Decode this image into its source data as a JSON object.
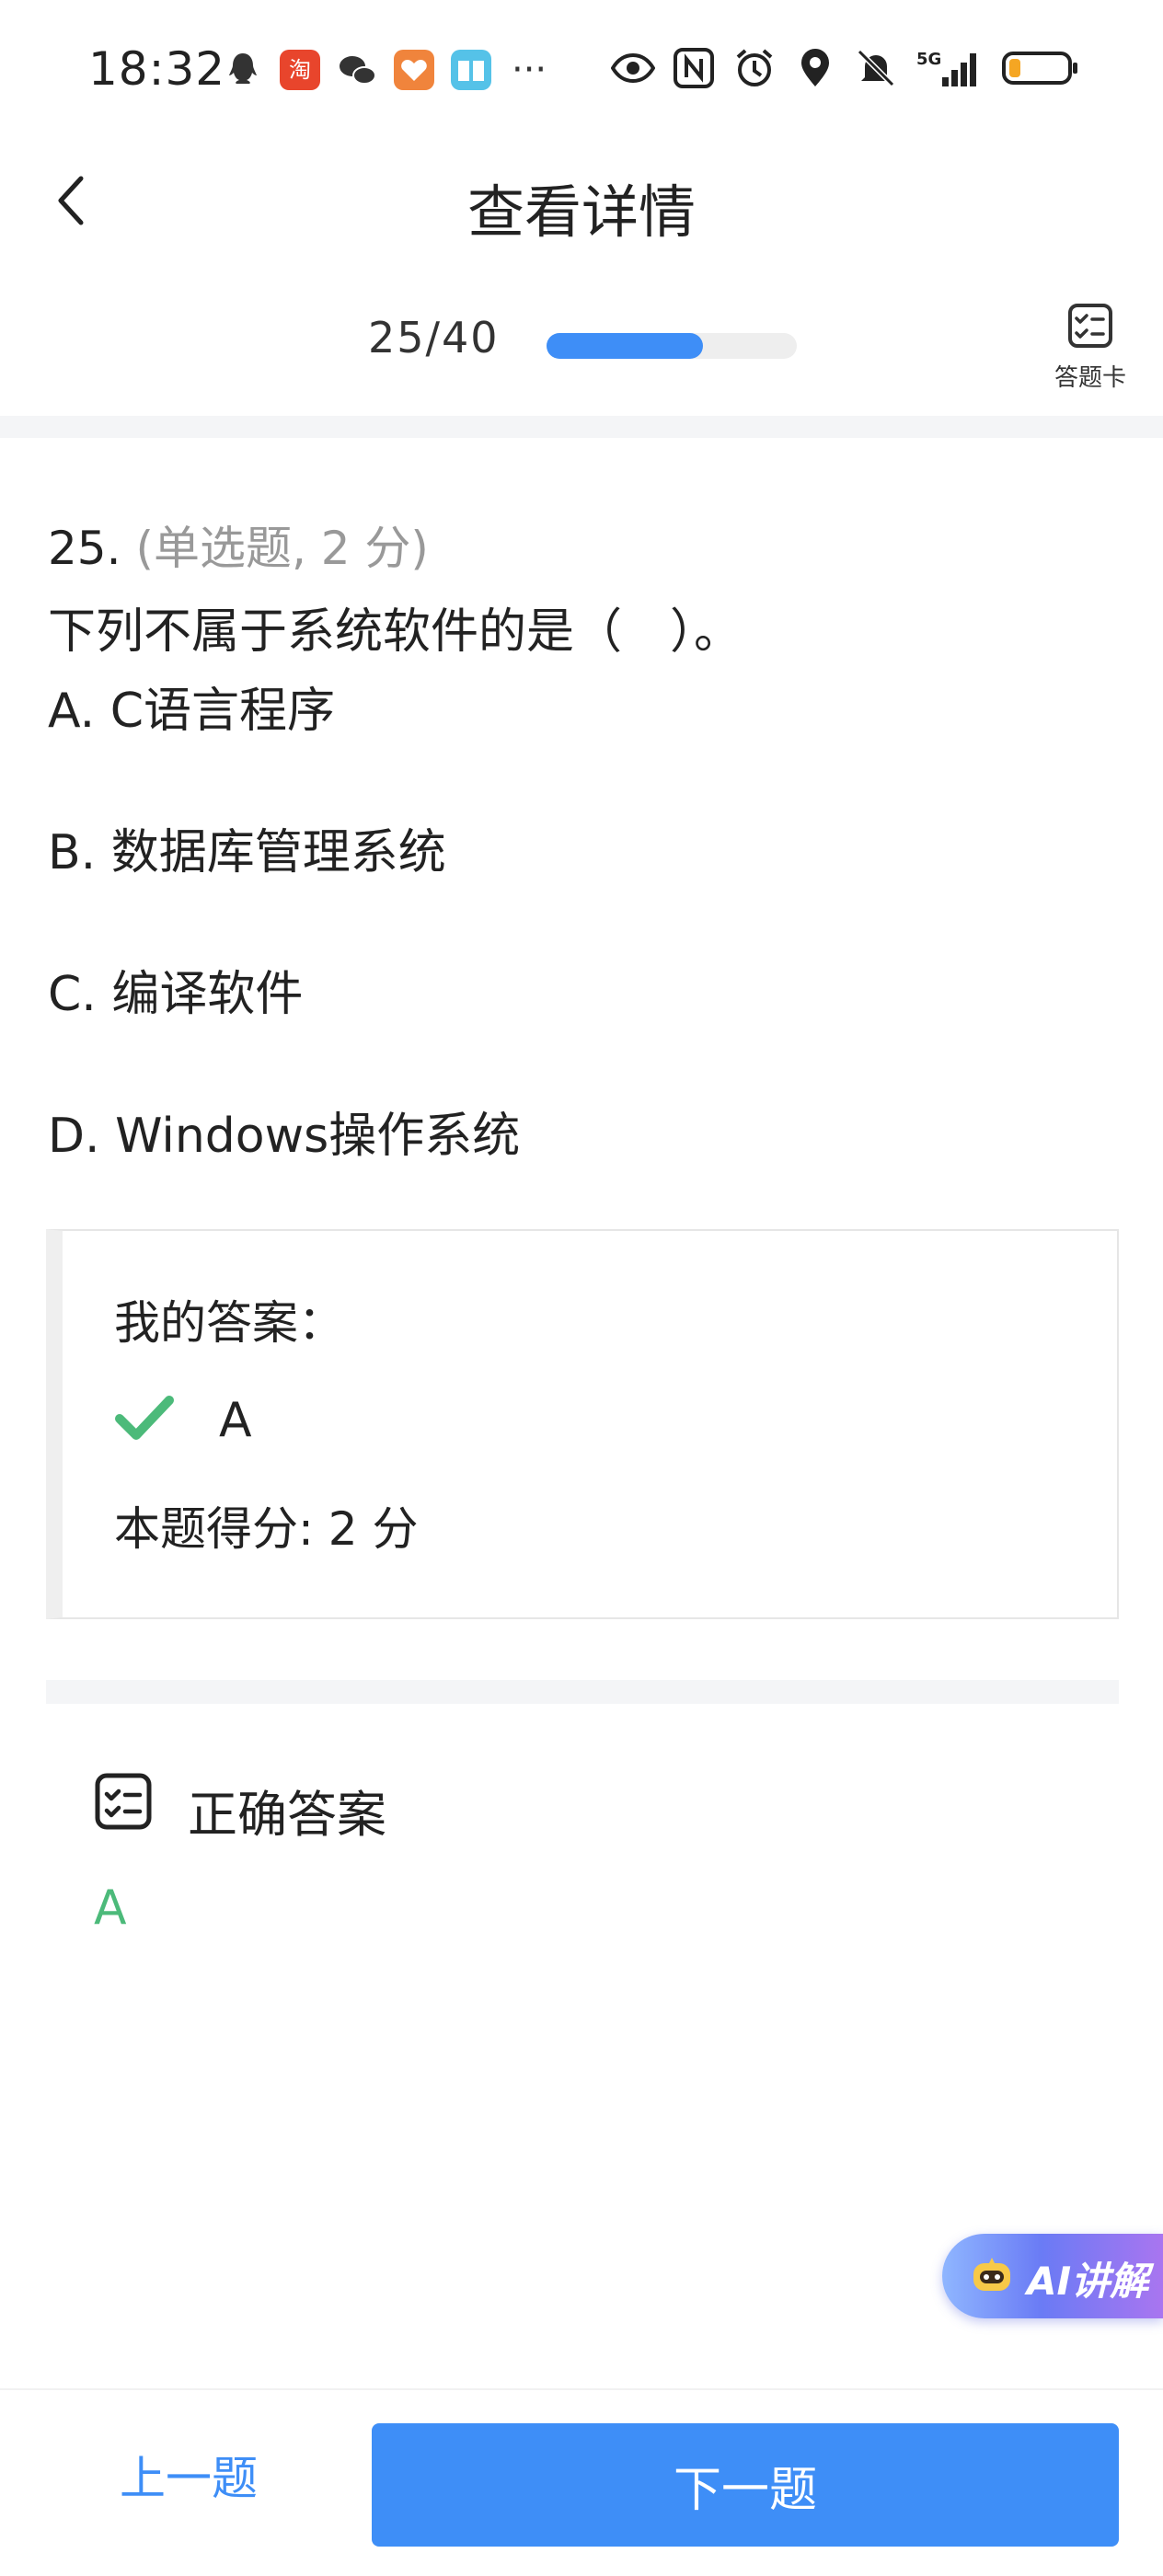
{
  "status_bar": {
    "time": "18:32",
    "left_icons": [
      "qq-icon",
      "taobao-icon",
      "wechat-icon",
      "heart-app-icon",
      "book-app-icon",
      "more-dots-icon"
    ],
    "more_glyph": "···",
    "right_icons": [
      "eye-icon",
      "nfc-icon",
      "alarm-icon",
      "location-icon",
      "mute-icon",
      "5g-signal-icon",
      "battery-icon"
    ],
    "network": "5G",
    "battery_level": 0.2,
    "battery_color": "#f5a623"
  },
  "header": {
    "title": "查看详情",
    "back_icon": "chevron-left-icon"
  },
  "progress": {
    "text": "25/40",
    "fraction": 0.625,
    "answer_card_label": "答题卡",
    "answer_card_icon": "checklist-icon"
  },
  "question": {
    "number": "25.",
    "type": "(单选题, 2 分)",
    "stem": "下列不属于系统软件的是（　）。",
    "options": [
      "A. C语言程序",
      "B. 数据库管理系统",
      "C. 编译软件",
      "D. Windows操作系统"
    ]
  },
  "my_answer": {
    "label": "我的答案：",
    "value": "A",
    "status_icon": "check-icon",
    "score": "本题得分:   2 分"
  },
  "correct_answer": {
    "title": "正确答案",
    "icon": "checklist-icon",
    "value": "A"
  },
  "ai_button": {
    "label": "AI讲解",
    "icon": "robot-icon"
  },
  "bottom": {
    "prev": "上一题",
    "next": "下一题"
  },
  "colors": {
    "accent": "#3e8ef7",
    "correct": "#4cba7a",
    "muted": "#999999"
  }
}
